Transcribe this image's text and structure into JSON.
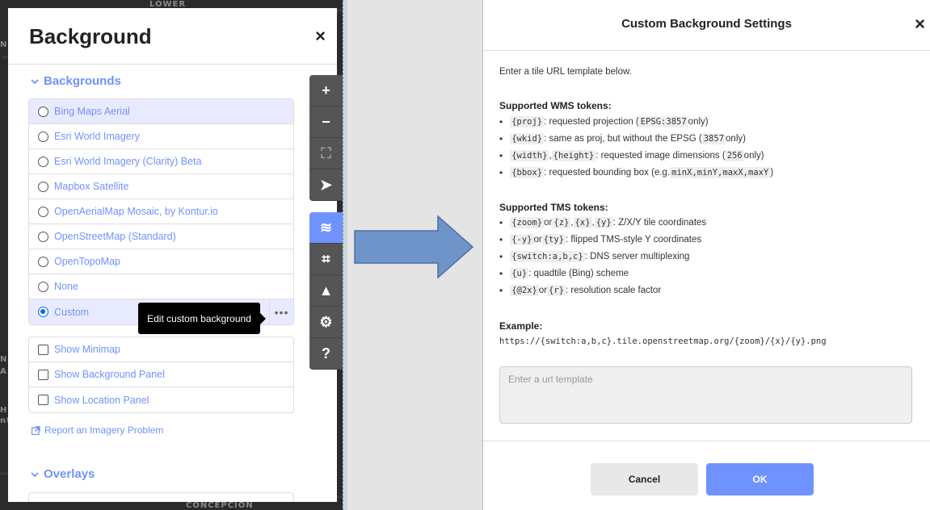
{
  "map": {
    "labels": [
      "LOWER",
      "CONCEPCION"
    ],
    "edge_letters": [
      "N",
      "N",
      "A",
      "H",
      "nt"
    ]
  },
  "background_pane": {
    "title": "Background",
    "close_icon": "×",
    "backgrounds_section": "Backgrounds",
    "backgrounds": [
      {
        "label": "Bing Maps Aerial",
        "checked": false,
        "active": true
      },
      {
        "label": "Esri World Imagery",
        "checked": false
      },
      {
        "label": "Esri World Imagery (Clarity) Beta",
        "checked": false
      },
      {
        "label": "Mapbox Satellite",
        "checked": false
      },
      {
        "label": "OpenAerialMap Mosaic, by Kontur.io",
        "checked": false
      },
      {
        "label": "OpenStreetMap (Standard)",
        "checked": false
      },
      {
        "label": "OpenTopoMap",
        "checked": false
      },
      {
        "label": "None",
        "checked": false
      },
      {
        "label": "Custom",
        "checked": true,
        "active": true
      }
    ],
    "custom_more": "•••",
    "tooltip": "Edit custom background",
    "options": [
      {
        "label": "Show Minimap"
      },
      {
        "label": "Show Background Panel"
      },
      {
        "label": "Show Location Panel"
      }
    ],
    "report_link": "Report an Imagery Problem",
    "overlays_section": "Overlays"
  },
  "map_controls": [
    {
      "name": "zoom-in-icon",
      "glyph": "+"
    },
    {
      "name": "zoom-out-icon",
      "glyph": "−"
    },
    {
      "name": "zoom-to-selection-icon",
      "glyph": "⛶"
    },
    {
      "name": "geolocate-icon",
      "glyph": "➤"
    },
    {
      "name": "background-layers-icon",
      "glyph": "≋"
    },
    {
      "name": "map-data-icon",
      "glyph": "⌗"
    },
    {
      "name": "issues-icon",
      "glyph": "▲"
    },
    {
      "name": "preferences-icon",
      "glyph": "⚙"
    },
    {
      "name": "help-icon",
      "glyph": "?"
    }
  ],
  "modal": {
    "title": "Custom Background Settings",
    "close_icon": "×",
    "intro": "Enter a tile URL template below.",
    "wms_heading": "Supported WMS tokens:",
    "wms_tokens": [
      {
        "code": "{proj}",
        "text": ": requested projection (",
        "code2": "EPSG:3857",
        "text2": " only)"
      },
      {
        "code": "{wkid}",
        "text": ": same as proj, but without the EPSG (",
        "code2": "3857",
        "text2": " only)"
      },
      {
        "code": "{width}",
        "text": ", ",
        "code2": "{height}",
        "text2": ": requested image dimensions (",
        "code3": "256",
        "text3": " only)"
      },
      {
        "code": "{bbox}",
        "text": ": requested bounding box (e.g. ",
        "code2": "minX,minY,maxX,maxY",
        "text2": ")"
      }
    ],
    "tms_heading": "Supported TMS tokens:",
    "tms_tokens": [
      {
        "code": "{zoom}",
        "text": " or ",
        "code2": "{z}",
        "text2": ", ",
        "code3": "{x}",
        "text3": ", ",
        "code4": "{y}",
        "text4": ": Z/X/Y tile coordinates"
      },
      {
        "code": "{-y}",
        "text": " or ",
        "code2": "{ty}",
        "text2": ": flipped TMS-style Y coordinates"
      },
      {
        "code": "{switch:a,b,c}",
        "text": ": DNS server multiplexing"
      },
      {
        "code": "{u}",
        "text": ": quadtile (Bing) scheme"
      },
      {
        "code": "{@2x}",
        "text": " or ",
        "code2": "{r}",
        "text2": ": resolution scale factor"
      }
    ],
    "example_heading": "Example:",
    "example_url": "https://{switch:a,b,c}.tile.openstreetmap.org/{zoom}/{x}/{y}.png",
    "input_placeholder": "Enter a url template",
    "input_value": "",
    "cancel_label": "Cancel",
    "ok_label": "OK"
  },
  "colors": {
    "accent": "#7092ff",
    "control_bg": "#555555",
    "arrow_fill": "#6f94c9"
  }
}
